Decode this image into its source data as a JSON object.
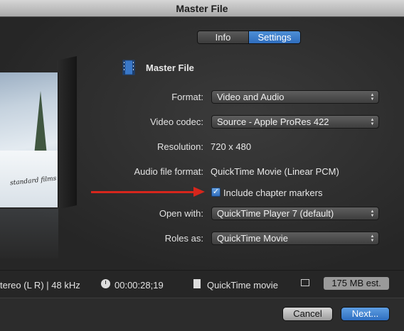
{
  "window": {
    "title": "Master File"
  },
  "tabs": {
    "info": "Info",
    "settings": "Settings",
    "selected": "settings"
  },
  "header": {
    "title": "Master File",
    "icon": "film-document-icon"
  },
  "thumbnail": {
    "caption": "standard films"
  },
  "settings": {
    "format": {
      "label": "Format:",
      "value": "Video and Audio"
    },
    "video_codec": {
      "label": "Video codec:",
      "value": "Source - Apple ProRes 422"
    },
    "resolution": {
      "label": "Resolution:",
      "value": "720 x 480"
    },
    "audio_file_format": {
      "label": "Audio file format:",
      "value": "QuickTime Movie (Linear PCM)"
    },
    "chapter_markers": {
      "label": "Include chapter markers",
      "checked": true
    },
    "open_with": {
      "label": "Open with:",
      "value": "QuickTime Player 7 (default)"
    },
    "roles_as": {
      "label": "Roles as:",
      "value": "QuickTime Movie"
    }
  },
  "annotation": {
    "color": "#d7261c"
  },
  "status": {
    "audio": "tereo (L R) | 48 kHz",
    "duration": "00:00:28;19",
    "file_type": "QuickTime movie",
    "size_estimate": "175 MB est."
  },
  "footer": {
    "cancel": "Cancel",
    "next": "Next..."
  },
  "colors": {
    "accent": "#2f6dbd"
  }
}
